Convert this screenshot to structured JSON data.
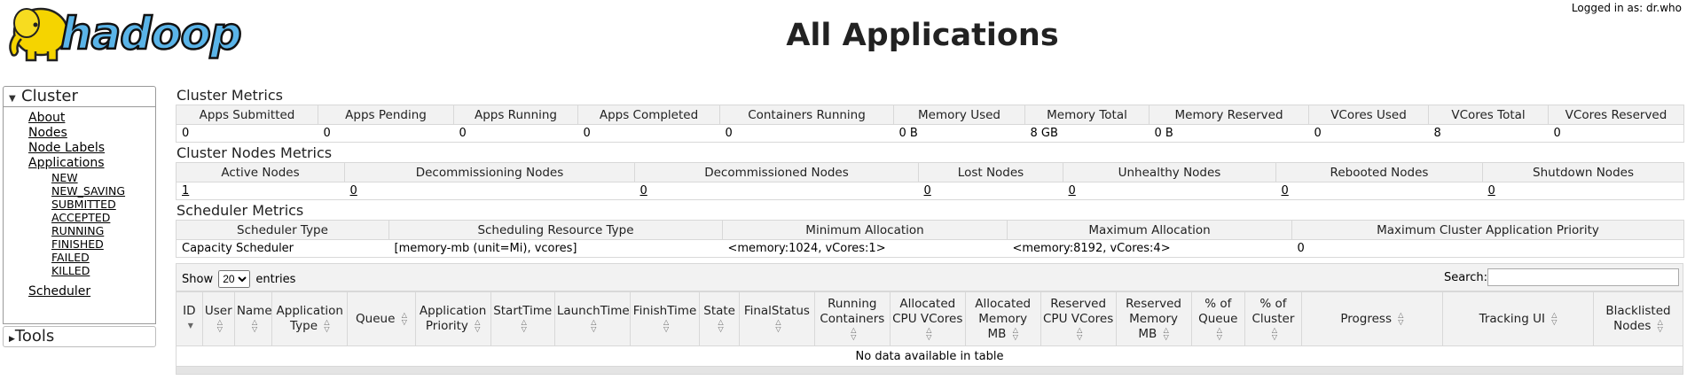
{
  "header": {
    "logo_text": "hadoop",
    "title": "All Applications",
    "login_info": "Logged in as: dr.who"
  },
  "sidebar": {
    "cluster_label": "Cluster",
    "tools_label": "Tools",
    "items": [
      {
        "label": "About"
      },
      {
        "label": "Nodes"
      },
      {
        "label": "Node Labels"
      },
      {
        "label": "Applications"
      }
    ],
    "app_states": [
      "NEW",
      "NEW_SAVING",
      "SUBMITTED",
      "ACCEPTED",
      "RUNNING",
      "FINISHED",
      "FAILED",
      "KILLED"
    ],
    "scheduler_label": "Scheduler"
  },
  "cluster_metrics": {
    "title": "Cluster Metrics",
    "headers": [
      "Apps Submitted",
      "Apps Pending",
      "Apps Running",
      "Apps Completed",
      "Containers Running",
      "Memory Used",
      "Memory Total",
      "Memory Reserved",
      "VCores Used",
      "VCores Total",
      "VCores Reserved"
    ],
    "values": [
      "0",
      "0",
      "0",
      "0",
      "0",
      "0 B",
      "8 GB",
      "0 B",
      "0",
      "8",
      "0"
    ]
  },
  "node_metrics": {
    "title": "Cluster Nodes Metrics",
    "headers": [
      "Active Nodes",
      "Decommissioning Nodes",
      "Decommissioned Nodes",
      "Lost Nodes",
      "Unhealthy Nodes",
      "Rebooted Nodes",
      "Shutdown Nodes"
    ],
    "values": [
      "1",
      "0",
      "0",
      "0",
      "0",
      "0",
      "0"
    ]
  },
  "scheduler_metrics": {
    "title": "Scheduler Metrics",
    "headers": [
      "Scheduler Type",
      "Scheduling Resource Type",
      "Minimum Allocation",
      "Maximum Allocation",
      "Maximum Cluster Application Priority"
    ],
    "values": [
      "Capacity Scheduler",
      "[memory-mb (unit=Mi), vcores]",
      "<memory:1024, vCores:1>",
      "<memory:8192, vCores:4>",
      "0"
    ]
  },
  "apps_table": {
    "show_label": "Show",
    "entries_label": "entries",
    "page_length": "20",
    "search_label": "Search:",
    "search_value": "",
    "columns": [
      "ID",
      "User",
      "Name",
      "Application Type",
      "Queue",
      "Application Priority",
      "StartTime",
      "LaunchTime",
      "FinishTime",
      "State",
      "FinalStatus",
      "Running Containers",
      "Allocated CPU VCores",
      "Allocated Memory MB",
      "Reserved CPU VCores",
      "Reserved Memory MB",
      "% of Queue",
      "% of Cluster",
      "Progress",
      "Tracking UI",
      "Blacklisted Nodes"
    ],
    "empty_message": "No data available in table"
  }
}
